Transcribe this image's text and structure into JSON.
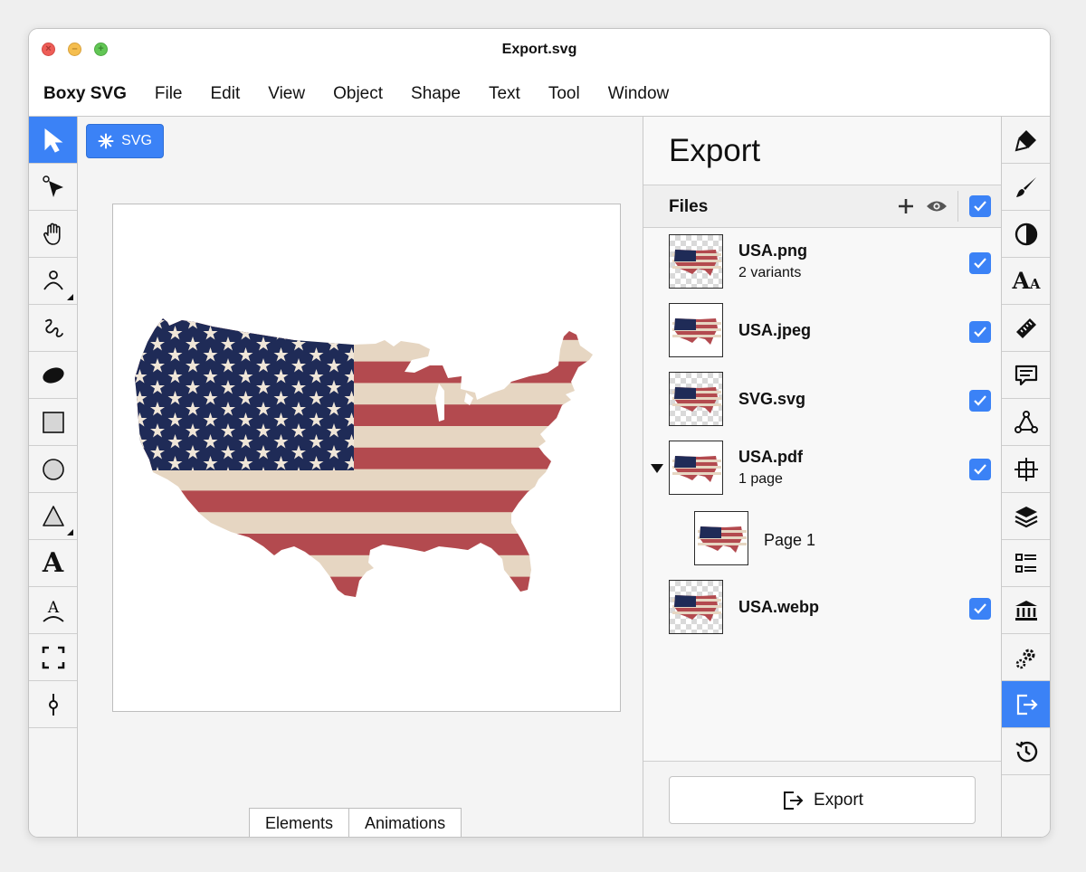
{
  "window": {
    "title": "Export.svg"
  },
  "traffic_lights": {
    "close_symbol": "×",
    "minimize_symbol": "–",
    "zoom_symbol": "+"
  },
  "menu": {
    "app_name": "Boxy SVG",
    "items": [
      "File",
      "Edit",
      "View",
      "Object",
      "Shape",
      "Text",
      "Tool",
      "Window"
    ]
  },
  "left_tools": [
    {
      "name": "select-tool",
      "icon": "arrow-cursor-icon",
      "active": true
    },
    {
      "name": "edit-tool",
      "icon": "node-arrow-icon",
      "active": false
    },
    {
      "name": "pan-tool",
      "icon": "hand-icon",
      "active": false
    },
    {
      "name": "pen-tool",
      "icon": "pen-nib-icon",
      "active": false
    },
    {
      "name": "freehand-tool",
      "icon": "squiggle-icon",
      "active": false
    },
    {
      "name": "ellipse-filled-tool",
      "icon": "ellipse-icon",
      "active": false
    },
    {
      "name": "rectangle-tool",
      "icon": "square-icon",
      "active": false
    },
    {
      "name": "circle-tool",
      "icon": "circle-icon",
      "active": false
    },
    {
      "name": "triangle-tool",
      "icon": "triangle-icon",
      "active": false
    },
    {
      "name": "text-tool",
      "icon": "letter-a-icon",
      "active": false
    },
    {
      "name": "text-on-path-tool",
      "icon": "text-path-icon",
      "active": false
    },
    {
      "name": "crop-tool",
      "icon": "crop-frame-icon",
      "active": false
    },
    {
      "name": "gradient-tool",
      "icon": "gradient-handle-icon",
      "active": false
    }
  ],
  "canvas": {
    "badge_label": "SVG",
    "bottom_tabs": [
      "Elements",
      "Animations"
    ]
  },
  "flag_colors": {
    "blue": "#1f2b57",
    "red": "#b34a4f",
    "cream": "#e6d6c2",
    "star": "#f0e6d8"
  },
  "accent_color": "#3b82f6",
  "export_panel": {
    "title": "Export",
    "files_label": "Files",
    "files": [
      {
        "name": "USA.png",
        "sub": "2 variants",
        "checker": true,
        "checked": true
      },
      {
        "name": "USA.jpeg",
        "sub": "",
        "checker": false,
        "checked": true
      },
      {
        "name": "SVG.svg",
        "sub": "",
        "checker": true,
        "checked": true
      },
      {
        "name": "USA.pdf",
        "sub": "1 page",
        "checker": false,
        "checked": true
      },
      {
        "name": "USA.webp",
        "sub": "",
        "checker": true,
        "checked": true
      }
    ],
    "pdf_page": {
      "name": "Page 1"
    },
    "export_button_label": "Export"
  },
  "right_panels": [
    {
      "icon": "paint-brush-fill-icon",
      "active": false
    },
    {
      "icon": "brush-stroke-icon",
      "active": false
    },
    {
      "icon": "contrast-icon",
      "active": false
    },
    {
      "icon": "typography-icon",
      "active": false
    },
    {
      "icon": "ruler-icon",
      "active": false
    },
    {
      "icon": "comment-icon",
      "active": false
    },
    {
      "icon": "node-graph-icon",
      "active": false
    },
    {
      "icon": "crosshair-grid-icon",
      "active": false
    },
    {
      "icon": "layers-icon",
      "active": false
    },
    {
      "icon": "list-icon",
      "active": false
    },
    {
      "icon": "library-icon",
      "active": false
    },
    {
      "icon": "gears-icon",
      "active": false
    },
    {
      "icon": "export-icon",
      "active": true
    },
    {
      "icon": "history-icon",
      "active": false
    }
  ]
}
